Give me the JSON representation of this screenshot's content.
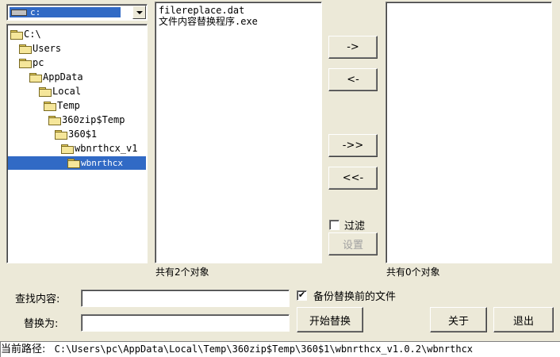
{
  "drive": {
    "selected": "c:"
  },
  "tree": {
    "items": [
      {
        "label": "C:\\"
      },
      {
        "label": "Users"
      },
      {
        "label": "pc"
      },
      {
        "label": "AppData"
      },
      {
        "label": "Local"
      },
      {
        "label": "Temp"
      },
      {
        "label": "360zip$Temp"
      },
      {
        "label": "360$1"
      },
      {
        "label": "wbnrthcx_v1"
      },
      {
        "label": "wbnrthcx"
      }
    ],
    "selected_label": "wbnrthcx"
  },
  "file_list": {
    "files": [
      "filereplace.dat",
      "文件内容替换程序.exe"
    ],
    "count_label": "共有2个对象"
  },
  "selected_list": {
    "count_label": "共有0个对象"
  },
  "buttons": {
    "add": "->",
    "remove": "<-",
    "add_all": "->>",
    "remove_all": "<<-",
    "settings": "设置",
    "start": "开始替换",
    "about": "关于",
    "exit": "退出"
  },
  "filter": {
    "label": "过滤",
    "checked": false
  },
  "backup": {
    "label": "备份替换前的文件",
    "checked": true
  },
  "find": {
    "label": "查找内容:",
    "value": ""
  },
  "replace": {
    "label": "替换为:",
    "value": ""
  },
  "status": {
    "label": "当前路径:",
    "path": "C:\\Users\\pc\\AppData\\Local\\Temp\\360zip$Temp\\360$1\\wbnrthcx_v1.0.2\\wbnrthcx"
  }
}
